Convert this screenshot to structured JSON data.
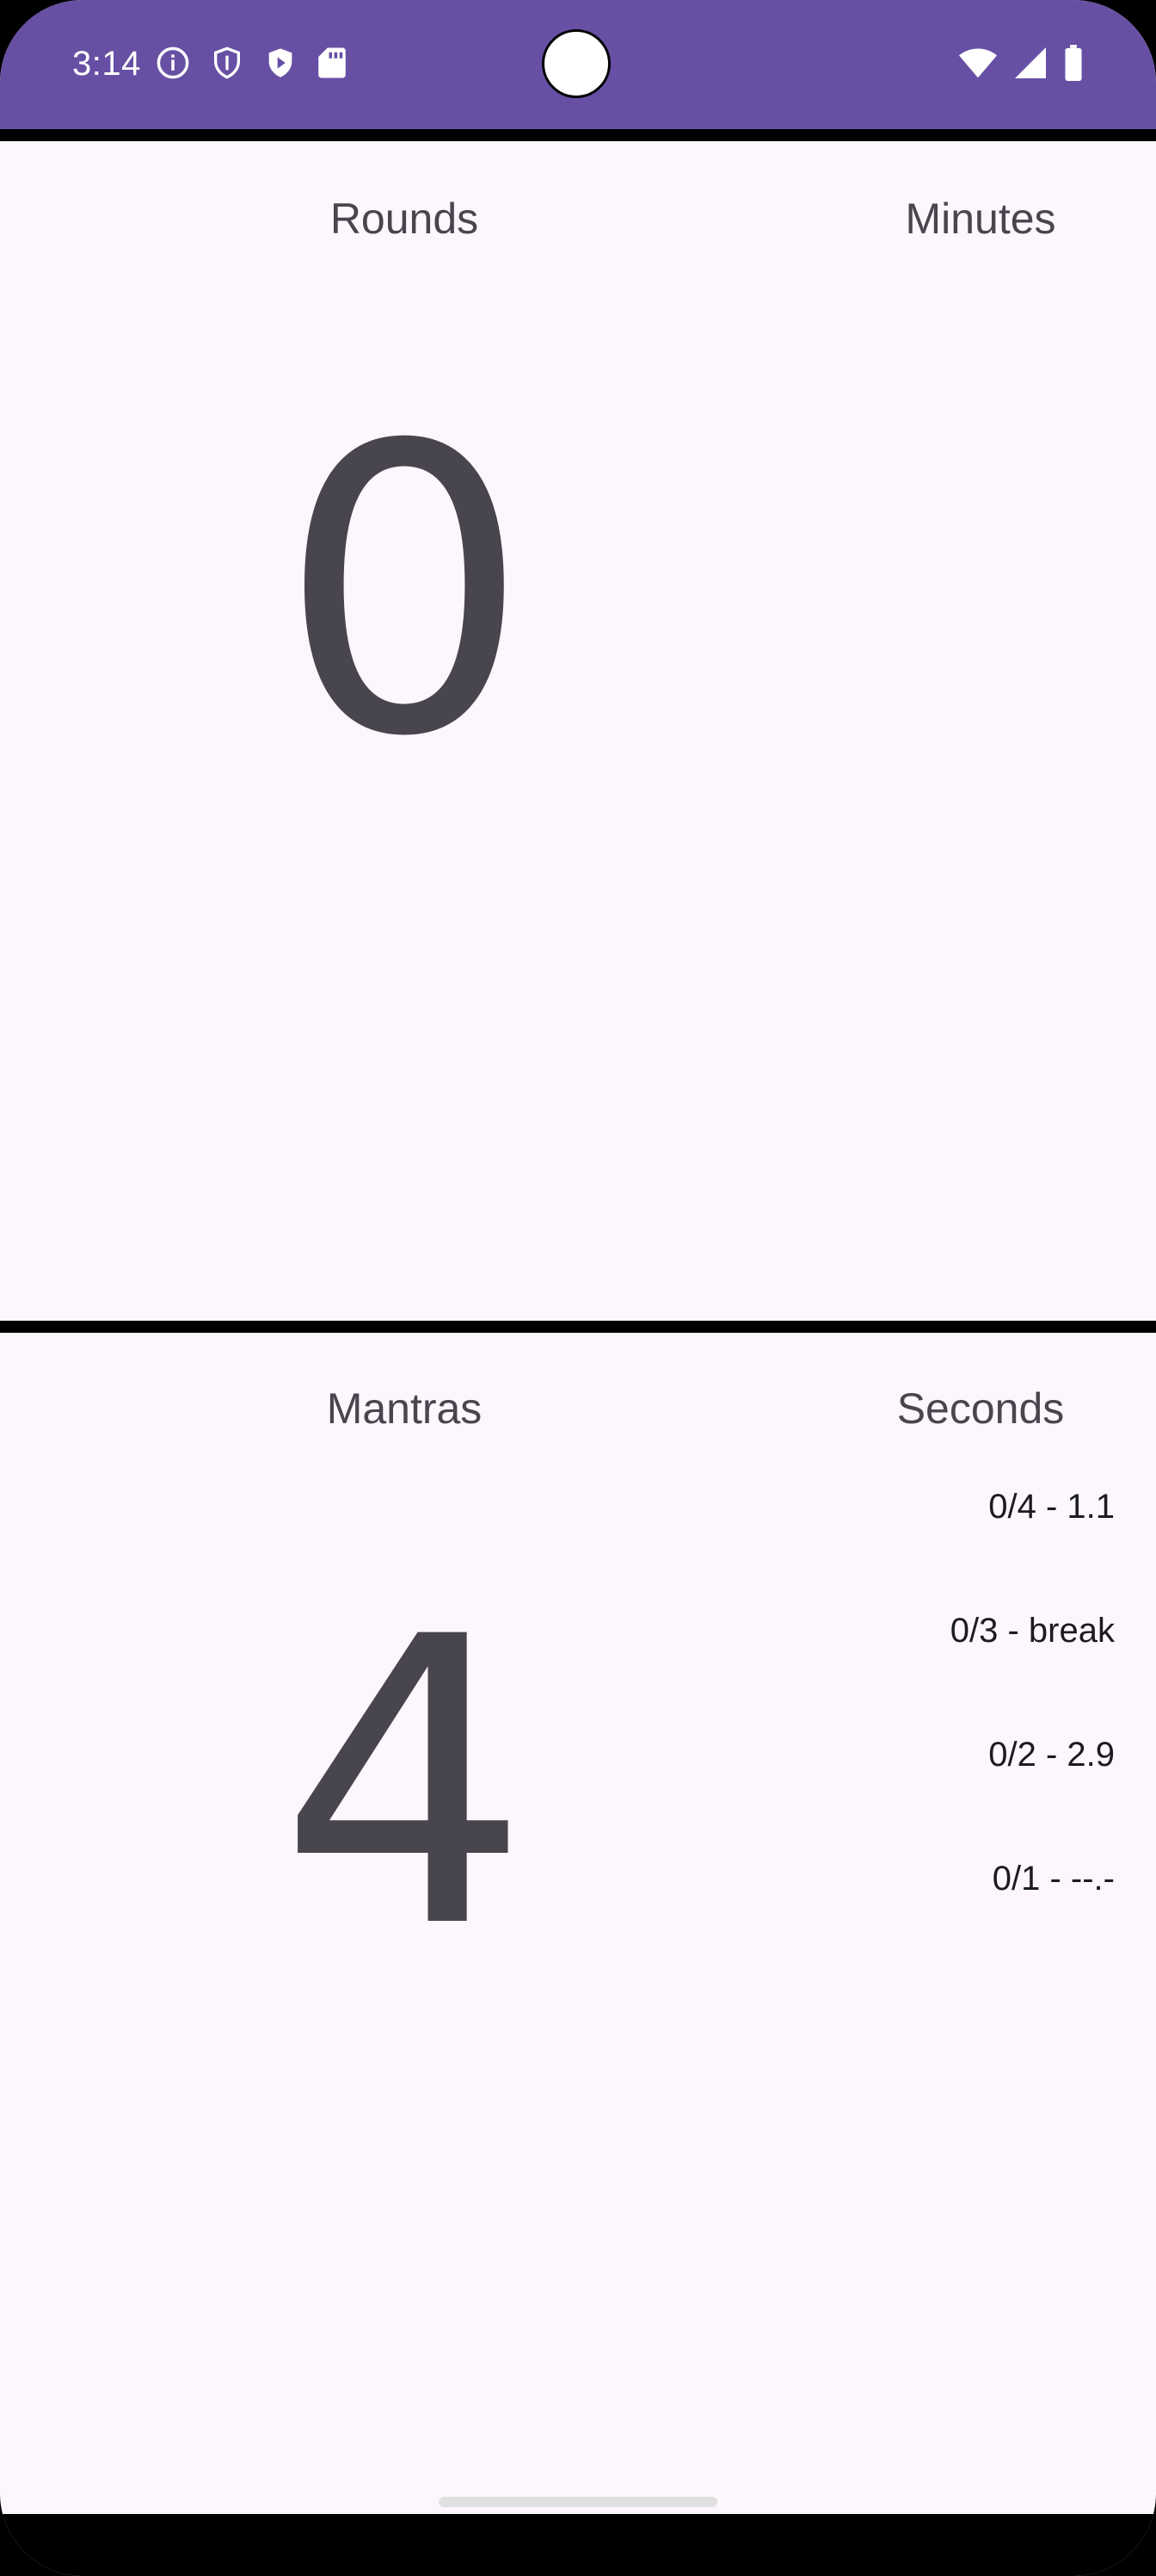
{
  "status_bar": {
    "time": "3:14",
    "left_icons": [
      "info-icon",
      "shield-icon",
      "play-shield-icon",
      "sd-card-icon"
    ],
    "right_icons": [
      "wifi-icon",
      "signal-icon",
      "battery-icon"
    ],
    "background": "#6750A4"
  },
  "top_panel": {
    "left_label": "Rounds",
    "right_label": "Minutes",
    "count": "0"
  },
  "bottom_panel": {
    "left_label": "Mantras",
    "right_label": "Seconds",
    "count": "4",
    "laps": [
      {
        "text": "0/4 - 1.1"
      },
      {
        "text": "0/3 - break"
      },
      {
        "text": "0/2 - 2.9"
      },
      {
        "text": "0/1 - --.-"
      }
    ]
  },
  "colors": {
    "surface": "#FDF6FD",
    "on_surface_variant": "#49454F",
    "accent": "#6750A4"
  }
}
